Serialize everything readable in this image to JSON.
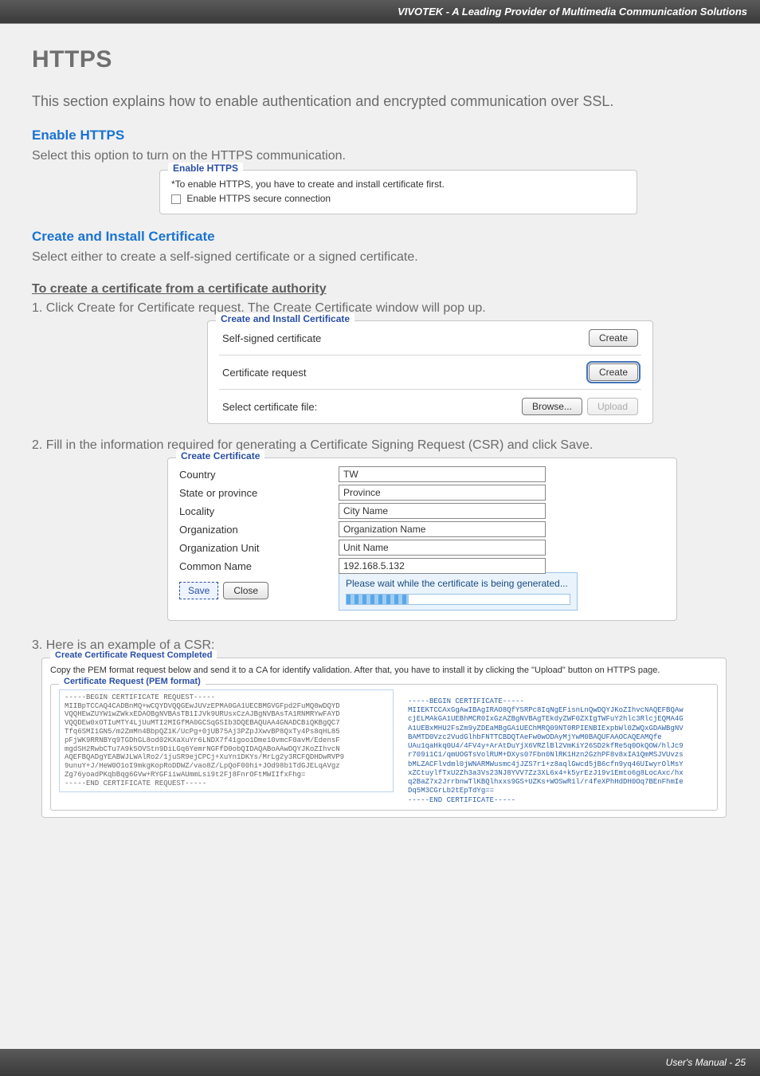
{
  "topbar": "VIVOTEK - A Leading Provider of Multimedia Communication Solutions",
  "h1": "HTTPS",
  "intro": "This section explains how to enable authentication and encrypted communication over SSL.",
  "sec_enable": {
    "title": "Enable HTTPS",
    "desc": "Select this option to turn on the HTTPS communication.",
    "fs_legend": "Enable HTTPS",
    "note": "*To enable HTTPS, you have to create and install certificate first.",
    "chk_label": "Enable HTTPS secure connection"
  },
  "sec_create": {
    "title": "Create and Install Certificate",
    "desc": "Select either to create a self-signed certificate or a signed certificate."
  },
  "howto_title": "To create a certificate from a certificate authority",
  "step1": "1. Click Create for Certificate request. The Create Certificate window will pop up.",
  "cici": {
    "legend": "Create and Install Certificate",
    "row1": "Self-signed certificate",
    "row2": "Certificate request",
    "row3": "Select certificate file:",
    "create": "Create",
    "browse": "Browse...",
    "upload": "Upload"
  },
  "step2": "2. Fill in the information required for generating a Certificate Signing Request (CSR) and click Save.",
  "cc": {
    "legend": "Create Certificate",
    "labels": {
      "country": "Country",
      "state": "State or province",
      "locality": "Locality",
      "org": "Organization",
      "unit": "Organization Unit",
      "common": "Common Name"
    },
    "values": {
      "country": "TW",
      "state": "Province",
      "locality": "City Name",
      "org": "Organization Name",
      "unit": "Unit Name",
      "common": "192.168.5.132"
    },
    "save": "Save",
    "close": "Close",
    "msg": "Please wait while the certificate is being generated..."
  },
  "step3": "3. Here is an example of a CSR:",
  "comp": {
    "legend": "Create Certificate Request Completed",
    "note": "Copy the PEM format request below and send it to a CA for identify validation. After that, you have to install it by clicking the \"Upload\" button on HTTPS page.",
    "pem_legend": "Certificate Request (PEM format)",
    "left": "-----BEGIN CERTIFICATE REQUEST-----\nMIIBpTCCAQ4CADBnMQ+wCQYDVQQGEwJUVzEPMA0GA1UECBMGVGFpd2FuMQ8wDQYD\nVQQHEwZUYW1wZWkxEDAOBgNVBAsTB1IJVk9URUsxCzAJBgNVBAsTA1RNMRYwFAYD\nVQQDEw0xOTIuMTY4LjUuMTI2MIGfMA0GCSqGSIb3DQEBAQUAA4GNADCBiQKBgQC7\nTfq6SMI1GN5/m2ZmMn4BbpQZ1K/UcPg+0jUB75Aj3PZpJXwvBP8QxTy4Ps8qHL85\npFjWK9RRNBYq9TGDhGL8od02KXaXuYr6LNDX7f41goo1Dme10vmcF0avM/EdensF\nmgdSH2RwbCTu7A9k5OVStn9DiLGq6YemrNGFfD0obQIDAQABoAAwDQYJKoZIhvcN\nAQEFBQADgYEABWJLWAlRo2/1juSR9ejCPCj+XuYn1DKYs/MrLg2y3RCFQDHDwRVP9\n9unuY+J/HeW0O1oI9mkgKopRoDDWZ/vao8Z/LpQoF00hi+JOd98b1TdGJELqAVgz\nZg76yoadPKqbBqg6GVw+RYGFiiwAUmmLsi9t2Fj8FnrOFtMWIIfxFhg=\n-----END CERTIFICATE REQUEST-----",
    "right": "-----BEGIN CERTIFICATE-----\nMIIEKTCCAxGgAwIBAgIRAO8QfYSRPc8IqNgEFisnLnQwDQYJKoZIhvcNAQEFBQAw\ncjELMAkGA1UEBhMCR0IxGzAZBgNVBAgTEkdyZWF0ZXIgTWFuY2hlc3RlcjEQMA4G\nA1UEBxMHU2FsZm9yZDEaMBgGA1UEChMRQ09NT0RPIENBIExpbWl0ZWQxGDAWBgNV\nBAMTD0Vzc2VudGlhbFNTTCBDQTAeFw0wODAyMjYwM0BAQUFAAOCAQEAMQfe\nUAu1qaHkq0U4/4FV4y+ArAtDuYjX6VRZlBl2VmKiY26SD2kfRe5q0OkQOW/hlJc9\nr709i1C1/qmUOGTsVolRUM+DXys07Fbn0NlRK1Hzn2GzhPF8v8xIA1QmMSJVUvzs\nbMLZACFlvdml0jWNARMWusmc4jJZS7r1+z8aqlGwcd5jB6cfn9yq46UIwyrOlMsY\nxZCtuylfTxU2Zh3a3Vs23NJ8YVV7Zz3XL6x4+k5yrEzJ19v1Emto6g8LocAxc/hx\nq2BaZ7x2JrrbnwTlKBQlhxxs9GS+UZKs+WOSwR1l/r4feXPhHdDH0Oq7BEnFhmIe\nDq5M3CGrLb2tEpTdYg==\n-----END CERTIFICATE-----"
  },
  "footer": "User's Manual - 25"
}
